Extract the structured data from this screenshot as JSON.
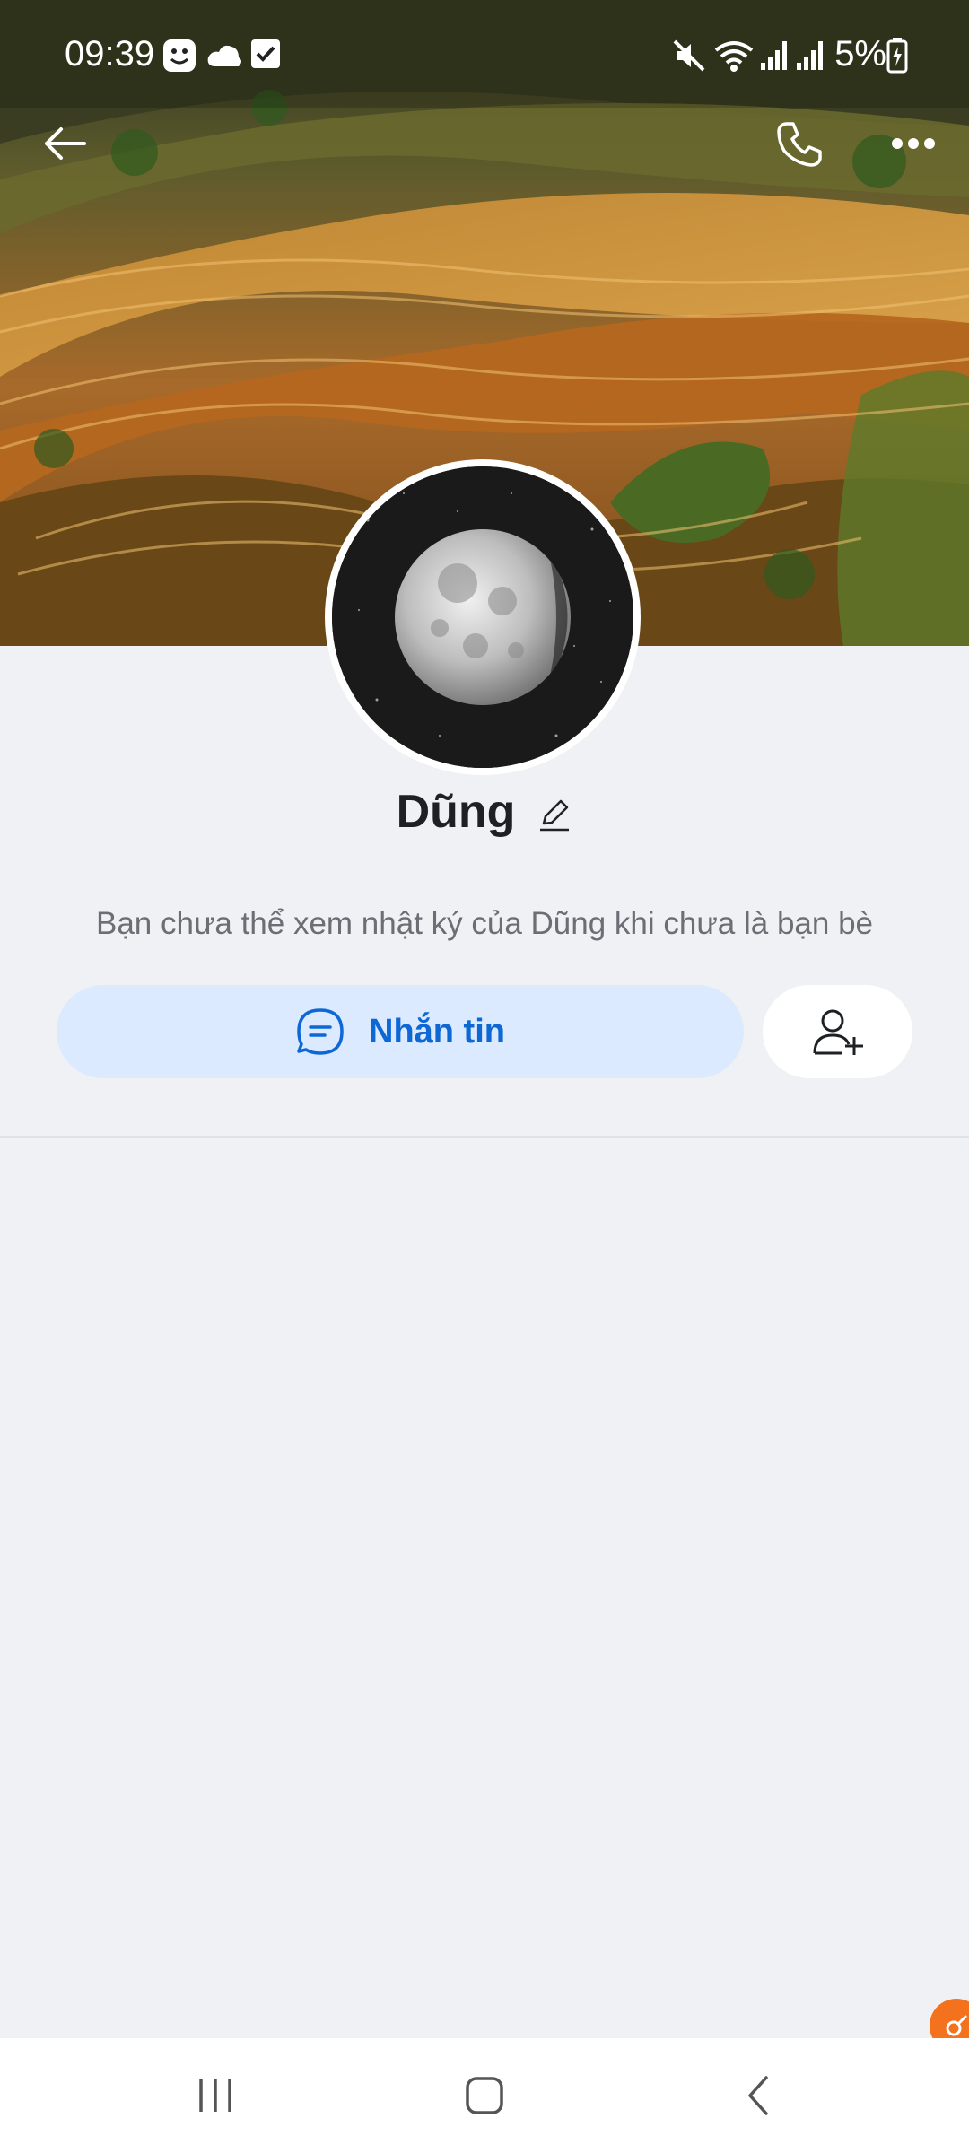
{
  "status_bar": {
    "time": "09:39",
    "battery": "5%"
  },
  "profile": {
    "name": "Dũng",
    "info": "Bạn chưa thể xem nhật ký của Dũng khi chưa là bạn bè"
  },
  "actions": {
    "message_label": "Nhắn tin"
  },
  "colors": {
    "accent": "#0d68d6",
    "message_button_bg": "#dbeafe",
    "page_bg": "#eff1f5",
    "float_badge": "#f4711d"
  },
  "icons": {
    "back": "arrow-left-icon",
    "call": "phone-icon",
    "more": "more-horizontal-icon",
    "edit": "pencil-icon",
    "chat": "chat-bubble-icon",
    "add_friend": "person-add-icon"
  }
}
